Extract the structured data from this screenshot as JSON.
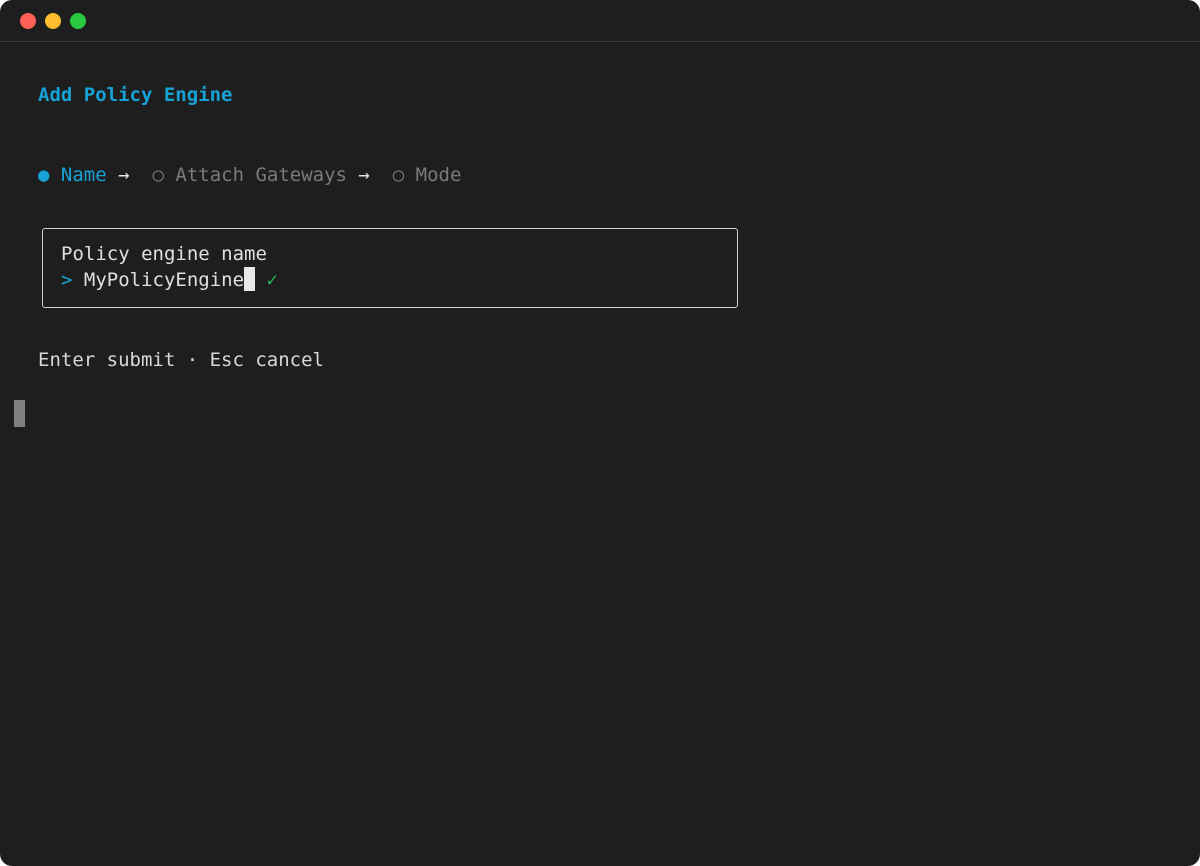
{
  "window": {
    "controls": [
      "close",
      "minimize",
      "maximize"
    ]
  },
  "terminal": {
    "title": "Add Policy Engine",
    "steps": [
      {
        "bullet": "●",
        "label": "Name",
        "state": "active"
      },
      {
        "bullet": "○",
        "label": "Attach Gateways",
        "state": "pending"
      },
      {
        "bullet": "○",
        "label": "Mode",
        "state": "pending"
      }
    ],
    "step_separator": "→",
    "field": {
      "label": "Policy engine name",
      "prompt": ">",
      "value": "MyPolicyEngine",
      "valid_mark": "✓"
    },
    "hint": "Enter submit · Esc cancel"
  },
  "colors": {
    "accent": "#17a2d6",
    "valid": "#1db954",
    "inactive": "#7a7a7a",
    "background": "#1e1e1e"
  }
}
